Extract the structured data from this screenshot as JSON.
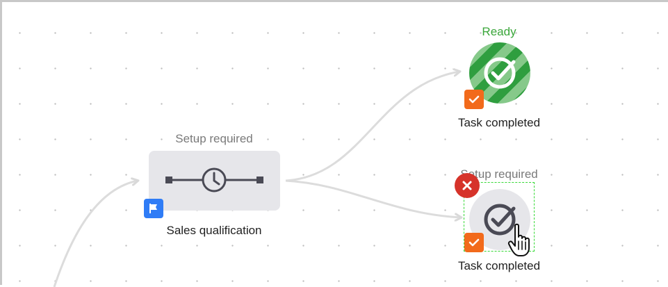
{
  "nodes": {
    "ready_task": {
      "status": "Ready",
      "label": "Task completed",
      "icon": "check-circle-icon",
      "badge_icon": "checkbox-icon",
      "status_color": "#3aa63a"
    },
    "timer": {
      "status": "Setup required",
      "label": "Sales qualification",
      "icon": "timer-clock-icon",
      "badge_icon": "flag-icon"
    },
    "pending_task": {
      "status": "Setup required",
      "label": "Task completed",
      "icon": "check-circle-icon",
      "badge_icon": "checkbox-icon",
      "selected": true,
      "delete_icon": "close-icon"
    }
  },
  "colors": {
    "ready_green": "#2f9e3f",
    "badge_orange": "#f26a1b",
    "badge_blue": "#2f7cf6",
    "delete_red": "#d6332a",
    "selection_green": "#35d935",
    "connector": "#dcdcdc"
  }
}
